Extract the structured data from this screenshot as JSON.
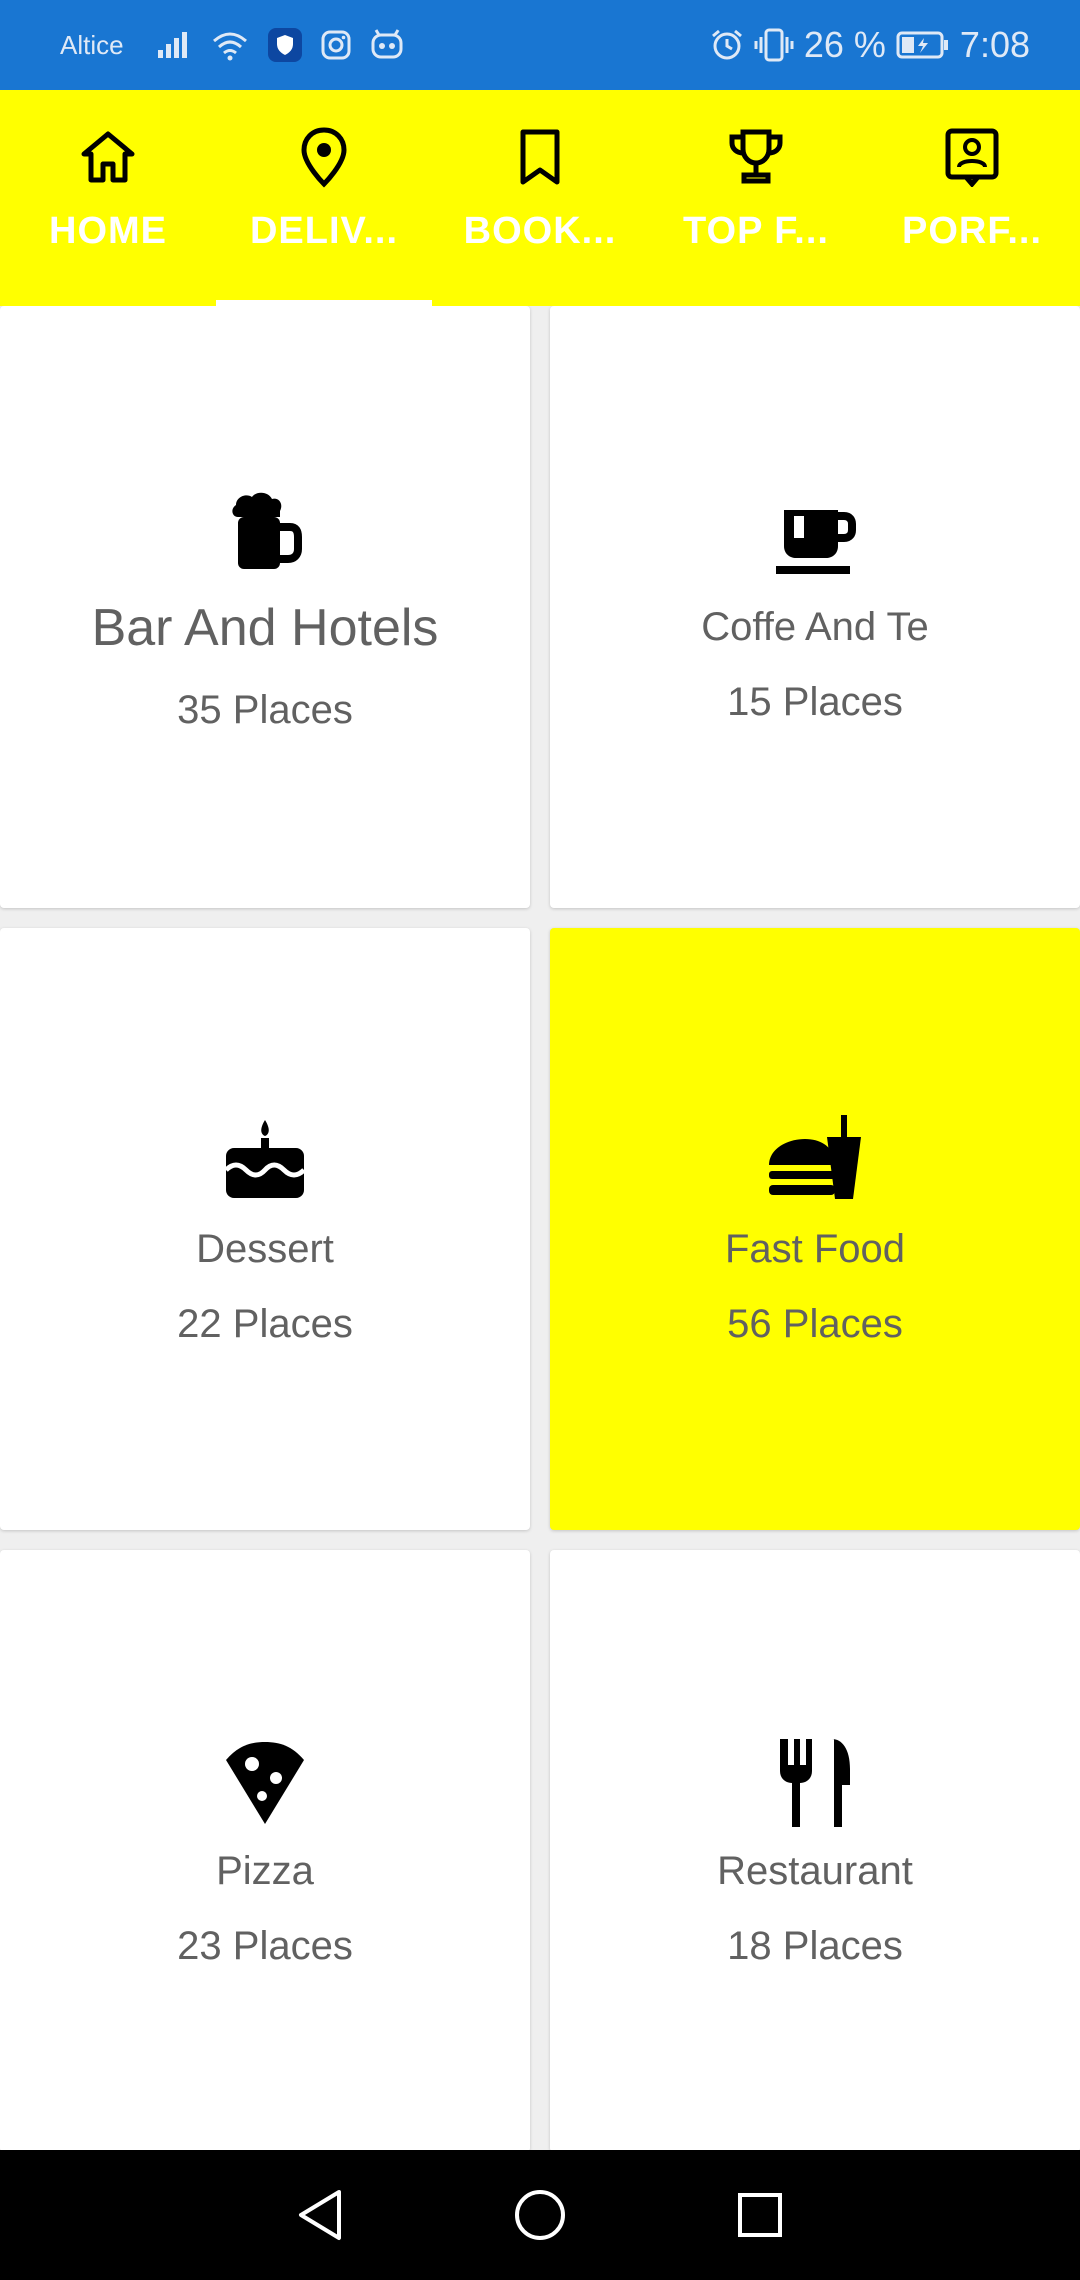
{
  "status_bar": {
    "carrier": "Altice",
    "battery_percent": "26 %",
    "time": "7:08",
    "background": "#1976d2",
    "left_icons": [
      "signal-icon",
      "wifi-icon",
      "shield-icon",
      "instagram-icon",
      "robot-icon"
    ],
    "right_icons": [
      "alarm-icon",
      "vibrate-icon",
      "battery-icon"
    ]
  },
  "tabs": [
    {
      "label": "HOME",
      "icon": "home-icon",
      "active": false
    },
    {
      "label": "DELIV...",
      "icon": "location-pin-icon",
      "active": true
    },
    {
      "label": "BOOK...",
      "icon": "bookmark-icon",
      "active": false
    },
    {
      "label": "TOP F...",
      "icon": "trophy-icon",
      "active": false
    },
    {
      "label": "PORF...",
      "icon": "profile-icon",
      "active": false
    }
  ],
  "accent_color": "#ffff00",
  "categories": [
    {
      "title": "Bar And Hotels",
      "count": "35 Places",
      "icon": "beer-mug-icon",
      "highlighted": false
    },
    {
      "title": "Coffe And Te",
      "count": "15 Places",
      "icon": "coffee-cup-icon",
      "highlighted": false
    },
    {
      "title": "Dessert",
      "count": "22 Places",
      "icon": "cake-icon",
      "highlighted": false
    },
    {
      "title": "Fast Food",
      "count": "56 Places",
      "icon": "fast-food-icon",
      "highlighted": true
    },
    {
      "title": "Pizza",
      "count": "23 Places",
      "icon": "pizza-icon",
      "highlighted": false
    },
    {
      "title": "Restaurant",
      "count": "18 Places",
      "icon": "restaurant-icon",
      "highlighted": false
    }
  ],
  "nav_bar": {
    "buttons": [
      "back-icon",
      "home-circle-icon",
      "recents-icon"
    ]
  }
}
